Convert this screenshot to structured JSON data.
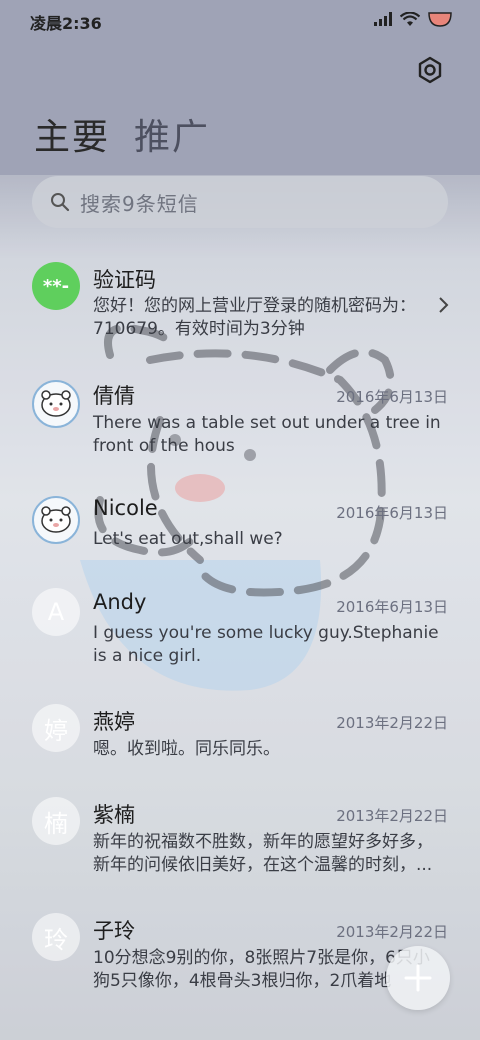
{
  "status_bar": {
    "time": "凌晨2:36"
  },
  "tabs": [
    {
      "label": "主要"
    },
    {
      "label": "推广"
    }
  ],
  "search": {
    "placeholder": "搜索9条短信"
  },
  "conversations": [
    {
      "avatar": "**-",
      "name": "验证码",
      "date": "",
      "preview": "您好！您的网上营业厅登录的随机密码为：710679。有效时间为3分钟"
    },
    {
      "avatar": "",
      "name": "倩倩",
      "date": "2016年6月13日",
      "preview": "There was a table set out under a tree in front of the hous"
    },
    {
      "avatar": "",
      "name": "Nicole",
      "date": "2016年6月13日",
      "preview": "Let's eat out,shall we?"
    },
    {
      "avatar": "A",
      "name": "Andy",
      "date": "2016年6月13日",
      "preview": "I guess you're some lucky guy.Stephanie is a nice girl."
    },
    {
      "avatar": "婷",
      "name": "燕婷",
      "date": "2013年2月22日",
      "preview": "嗯。收到啦。同乐同乐。"
    },
    {
      "avatar": "楠",
      "name": "紫楠",
      "date": "2013年2月22日",
      "preview": "新年的祝福数不胜数，新年的愿望好多好多，新年的问候依旧美好，在这个温馨的时刻，..."
    },
    {
      "avatar": "玲",
      "name": "子玲",
      "date": "2013年2月22日",
      "preview": "10分想念9别的你，8张照片7张是你，6只小狗5只像你，4根骨头3根归你，2爪着地"
    }
  ],
  "icons": {
    "settings": "gear-icon",
    "search": "search-icon",
    "compose": "plus-icon",
    "chevron": "chevron-right-icon"
  },
  "colors": {
    "verification_avatar": "#5fcf5d",
    "header": "#9fa3b6"
  }
}
